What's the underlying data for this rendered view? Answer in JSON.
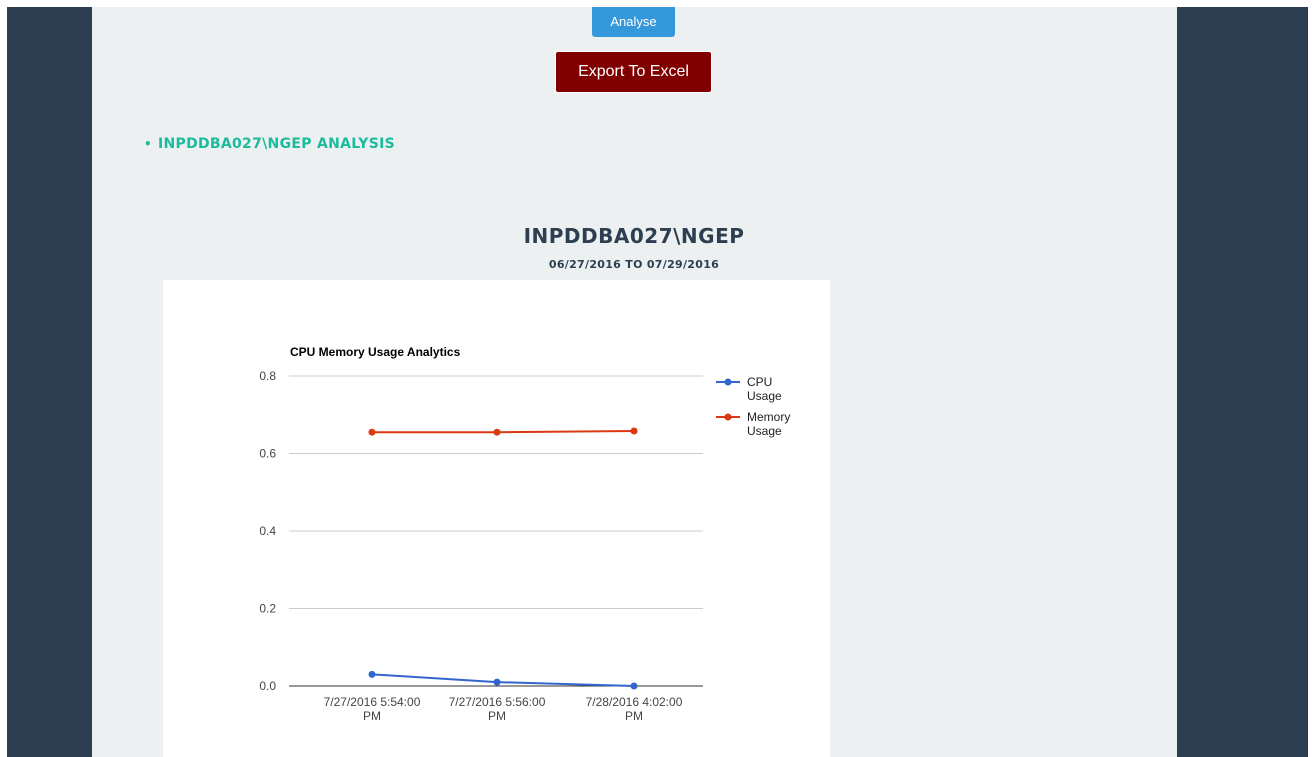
{
  "toolbar": {
    "analyse_label": "Analyse",
    "export_label": "Export To Excel"
  },
  "analysis_list": {
    "items": [
      "INPDDBA027\\NGEP ANALYSIS"
    ]
  },
  "report": {
    "server": "INPDDBA027\\NGEP",
    "date_range": "06/27/2016 TO 07/29/2016"
  },
  "colors": {
    "frame": "#2c3e50",
    "content_bg": "#ecf0f1",
    "analyse_button": "#3498db",
    "export_button": "#800000",
    "link_accent": "#1abc9c",
    "cpu_series": "#3366cc",
    "memory_series": "#dc3912"
  },
  "chart_data": {
    "type": "line",
    "title": "CPU Memory Usage Analytics",
    "xlabel": "",
    "ylabel": "",
    "categories": [
      [
        "7/27/2016 5:54:00",
        "PM"
      ],
      [
        "7/27/2016 5:56:00",
        "PM"
      ],
      [
        "7/28/2016 4:02:00",
        "PM"
      ]
    ],
    "series": [
      {
        "name": [
          "CPU",
          "Usage"
        ],
        "color": "#3366cc",
        "values": [
          0.03,
          0.01,
          0.0
        ]
      },
      {
        "name": [
          "Memory",
          "Usage"
        ],
        "color": "#dc3912",
        "values": [
          0.655,
          0.655,
          0.658
        ]
      }
    ],
    "ylim": [
      0,
      0.8
    ],
    "yticks": [
      "0.0",
      "0.2",
      "0.4",
      "0.6",
      "0.8"
    ],
    "grid": true,
    "legend_position": "right"
  }
}
